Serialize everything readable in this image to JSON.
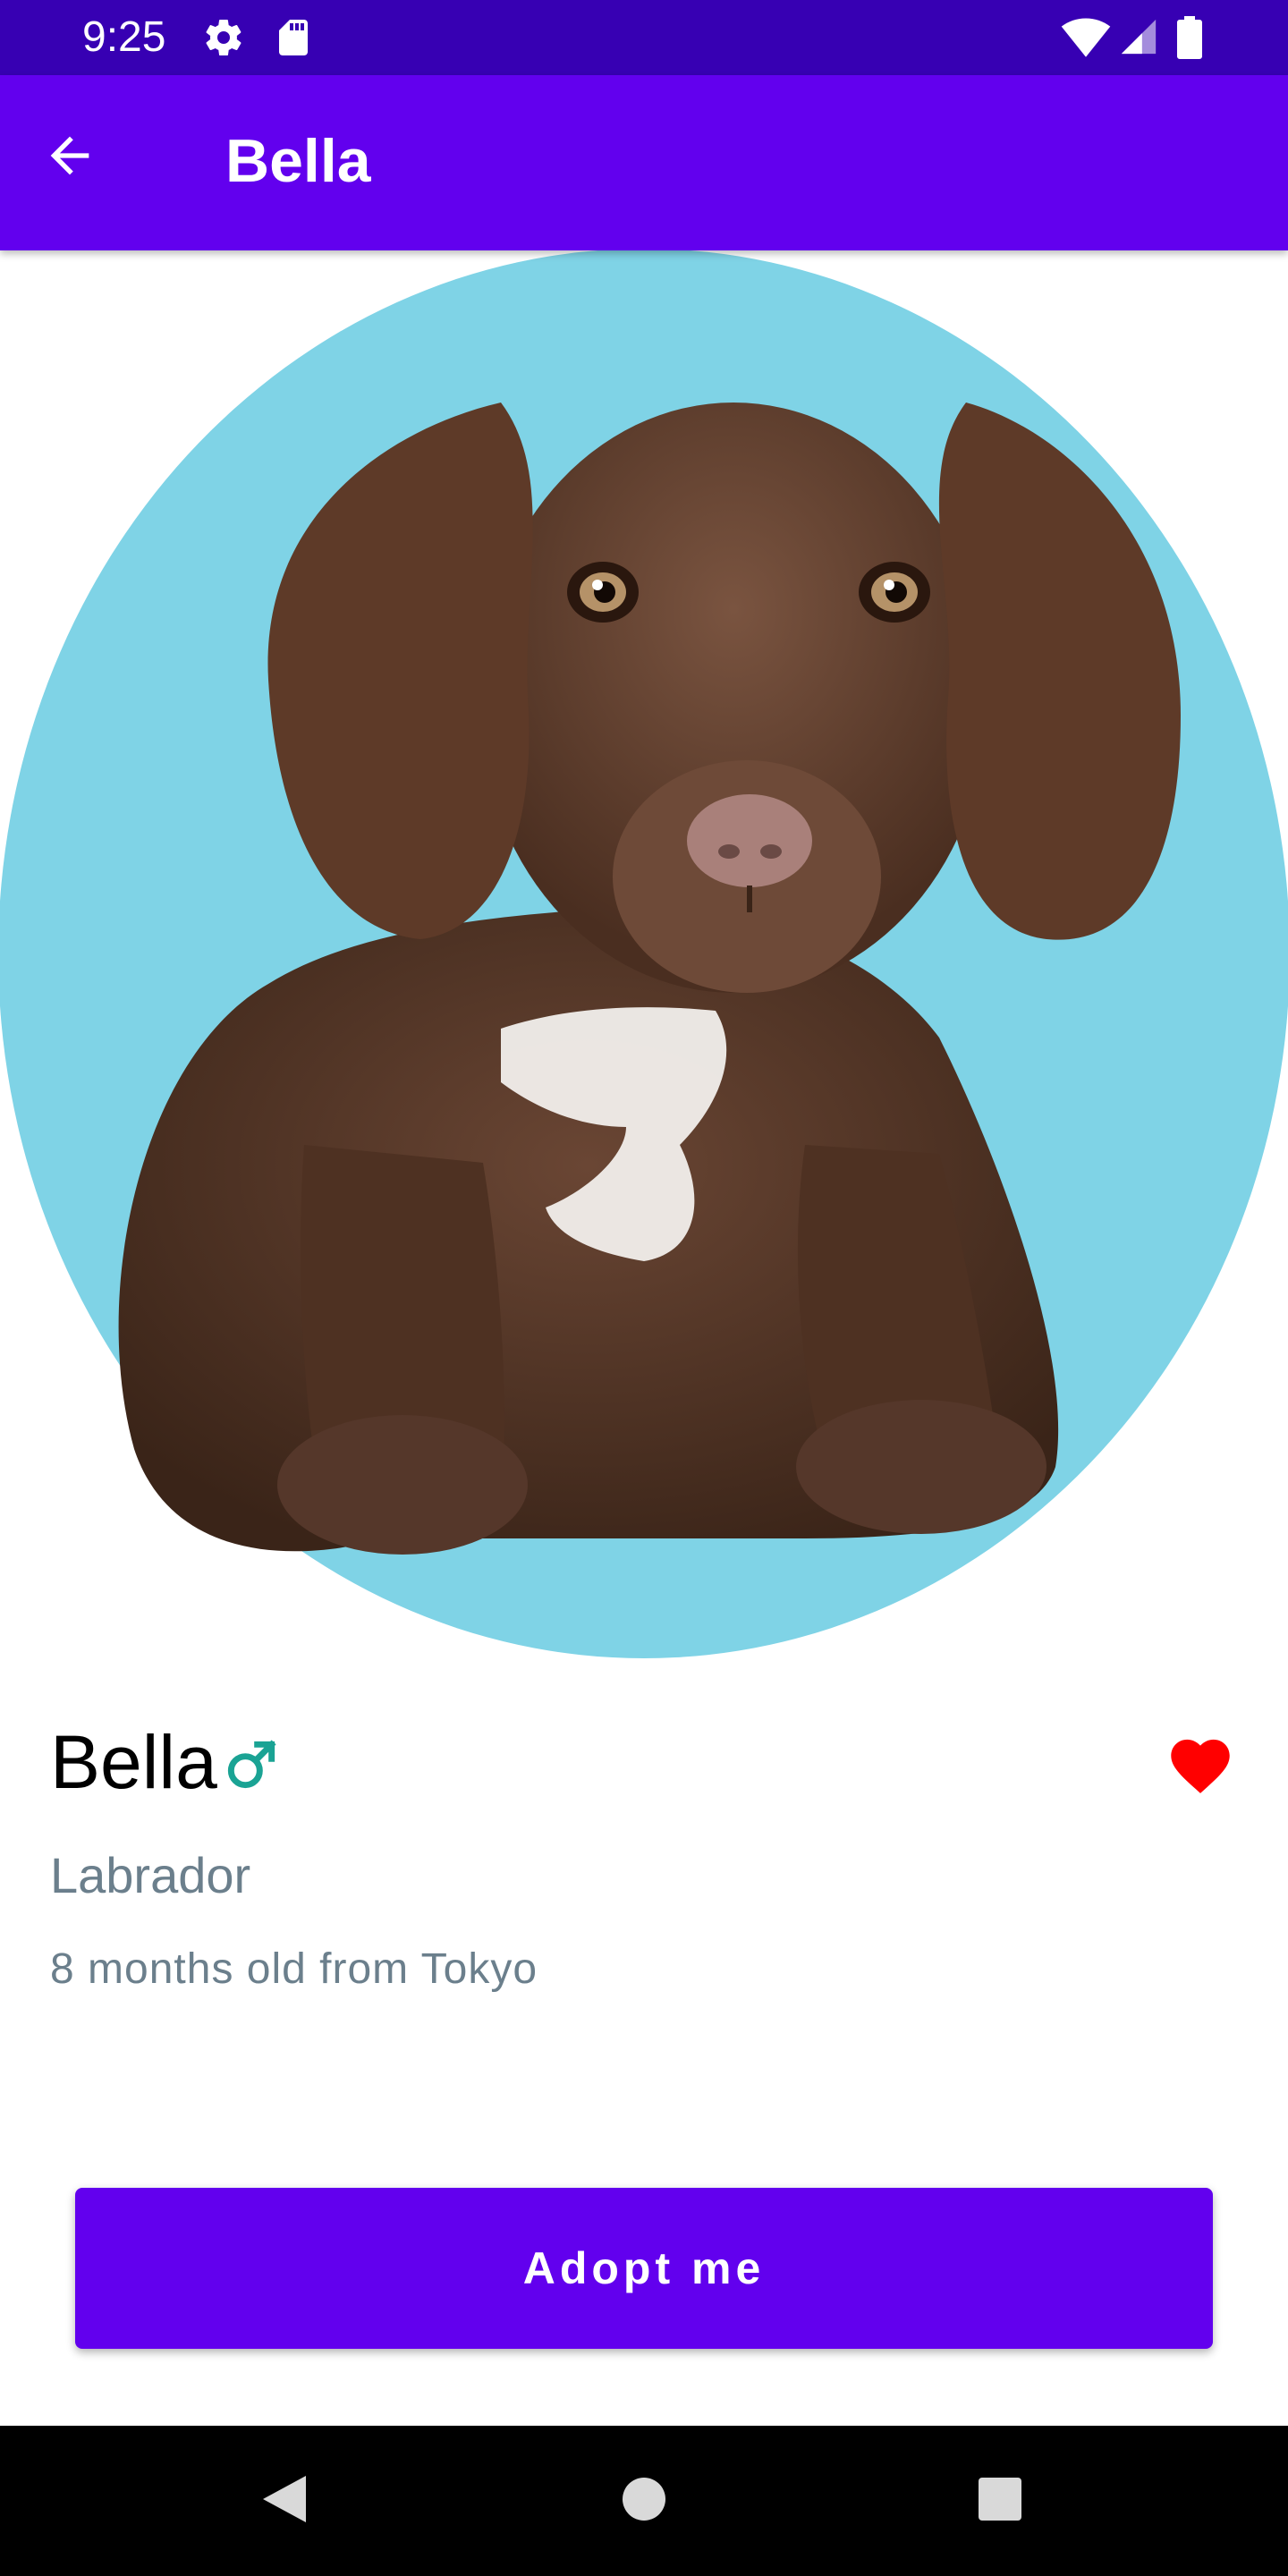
{
  "status_bar": {
    "time": "9:25",
    "icons": [
      "settings-icon",
      "sd-card-icon",
      "wifi-icon",
      "signal-icon",
      "battery-icon"
    ]
  },
  "app_bar": {
    "title": "Bella",
    "back_icon": "arrow-left-icon"
  },
  "hero": {
    "background_color": "#7fd3e6",
    "subject": "dog-image"
  },
  "pet": {
    "name": "Bella",
    "gender_symbol": "♂",
    "breed": "Labrador",
    "details": "8 months old from Tokyo",
    "favorite_icon": "heart-icon"
  },
  "actions": {
    "adopt_label": "Adopt me"
  },
  "navigation": {
    "buttons": [
      "back-triangle-icon",
      "home-circle-icon",
      "recents-square-icon"
    ]
  },
  "colors": {
    "primary": "#6200ee",
    "primary_dark": "#3700b3",
    "gender_accent": "#1aa394",
    "favorite": "#ff0000",
    "secondary_text": "#6b7f8c"
  }
}
